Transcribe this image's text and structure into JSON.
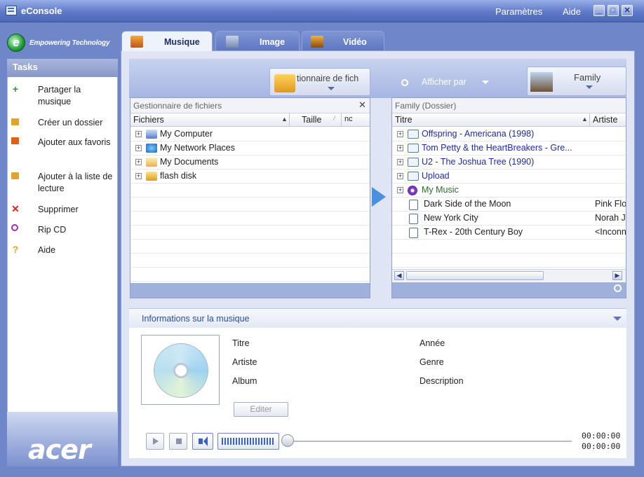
{
  "window": {
    "title": "eConsole",
    "menu": {
      "settings": "Paramètres",
      "help": "Aide"
    },
    "controls": {
      "minimize": "_",
      "maximize": "□",
      "close": "✕"
    }
  },
  "brand": {
    "tagline": "Empowering Technology",
    "logo_letter": "e",
    "footer_logo": "acer"
  },
  "tasks": {
    "header": "Tasks",
    "items": [
      {
        "label": "Partager la musique",
        "icon": "plus-icon",
        "color": "#2e9a2e"
      },
      {
        "label": "Créer un dossier",
        "icon": "new-folder-icon",
        "color": "#e0a52a"
      },
      {
        "label": "Ajouter aux favoris",
        "icon": "favorites-icon",
        "color": "#d9631b"
      },
      {
        "label": "Ajouter à la liste de lecture",
        "icon": "playlist-icon",
        "color": "#e0a52a"
      },
      {
        "label": "Supprimer",
        "icon": "delete-icon",
        "color": "#d7261e"
      },
      {
        "label": "Rip CD",
        "icon": "rip-cd-icon",
        "color": "#9b2fae"
      },
      {
        "label": "Aide",
        "icon": "help-icon",
        "color": "#e0a52a"
      }
    ]
  },
  "tabs": [
    {
      "label": "Musique",
      "active": true
    },
    {
      "label": "Image",
      "active": false
    },
    {
      "label": "Vidéo",
      "active": false
    }
  ],
  "toolbar": {
    "source_dropdown": "tionnaire de fich",
    "view_label": "Afficher par",
    "view_dropdown": "Family"
  },
  "left_pane": {
    "title": "Gestionnaire de fichiers",
    "columns": [
      "Fichiers",
      "Taille",
      "nc"
    ],
    "rows": [
      "My Computer",
      "My Network Places",
      "My Documents",
      "flash disk"
    ]
  },
  "right_pane": {
    "title": "Family (Dossier)",
    "columns": [
      "Titre",
      "Artiste"
    ],
    "folders": [
      {
        "title": "Offspring - Americana (1998)"
      },
      {
        "title": "Tom Petty & the HeartBreakers - Gre..."
      },
      {
        "title": "U2 - The Joshua Tree (1990)"
      },
      {
        "title": "Upload"
      },
      {
        "title": "My Music"
      }
    ],
    "tracks": [
      {
        "title": "Dark Side of the Moon",
        "artist": "Pink Flo"
      },
      {
        "title": "New York City",
        "artist": "Norah J"
      },
      {
        "title": "T-Rex - 20th Century Boy",
        "artist": "<Inconn"
      }
    ]
  },
  "info": {
    "header": "Informations sur la musique",
    "left_fields": [
      "Titre",
      "Artiste",
      "Album"
    ],
    "right_fields": [
      "Année",
      "Genre",
      "Description"
    ],
    "edit_button": "Editer"
  },
  "player": {
    "time_elapsed": "00:00:00",
    "time_total": "00:00:00",
    "volume_level": 1.0,
    "position": 0.0
  },
  "colors": {
    "accent": "#5f79c8",
    "link": "#1e2aa8",
    "music": "#2a6a2a"
  }
}
